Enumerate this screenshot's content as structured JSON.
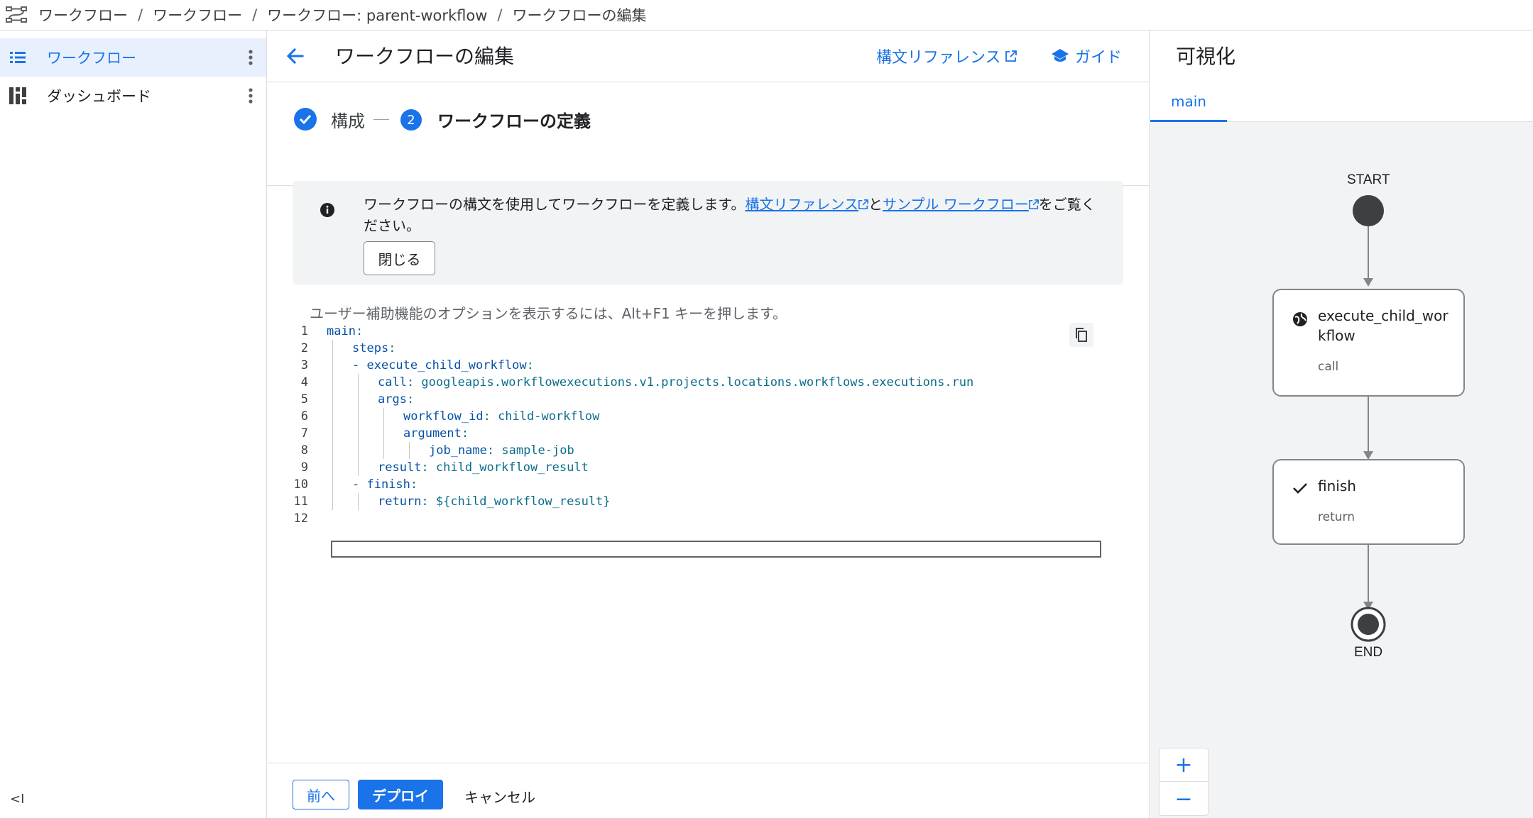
{
  "breadcrumb": {
    "items": [
      "ワークフロー",
      "ワークフロー",
      "ワークフロー: parent-workflow",
      "ワークフローの編集"
    ],
    "separator": "/"
  },
  "sidebar": {
    "items": [
      {
        "label": "ワークフロー",
        "icon": "list-icon",
        "active": true
      },
      {
        "label": "ダッシュボード",
        "icon": "dashboard-icon",
        "active": false
      }
    ],
    "collapse_label": "<I"
  },
  "editor": {
    "title": "ワークフローの編集",
    "syntax_ref_link": "構文リファレンス",
    "guide_link": "ガイド",
    "steps": [
      {
        "number": "1",
        "label": "構成",
        "done": true
      },
      {
        "number": "2",
        "label": "ワークフローの定義",
        "done": false
      }
    ],
    "info": {
      "text_before": "ワークフローの構文を使用してワークフローを定義します。",
      "link1": "構文リファレンス",
      "text_mid": "と",
      "link2": "サンプル ワークフロー",
      "text_after": "をご覧ください。",
      "close_label": "閉じる"
    },
    "a11y_hint": "ユーザー補助機能のオプションを表示するには、Alt+F1 キーを押します。",
    "code_lines": [
      {
        "n": "1",
        "indent": 0,
        "key": "main",
        "rest": ":"
      },
      {
        "n": "2",
        "indent": 1,
        "key": "steps",
        "rest": ":"
      },
      {
        "n": "3",
        "indent": 1,
        "key": "- execute_child_workflow",
        "rest": ":"
      },
      {
        "n": "4",
        "indent": 2,
        "key": "call",
        "rest": ": googleapis.workflowexecutions.v1.projects.locations.workflows.executions.run"
      },
      {
        "n": "5",
        "indent": 2,
        "key": "args",
        "rest": ":"
      },
      {
        "n": "6",
        "indent": 3,
        "key": "workflow_id",
        "rest": ": child-workflow"
      },
      {
        "n": "7",
        "indent": 3,
        "key": "argument",
        "rest": ":"
      },
      {
        "n": "8",
        "indent": 4,
        "key": "job_name",
        "rest": ": sample-job"
      },
      {
        "n": "9",
        "indent": 2,
        "key": "result",
        "rest": ": child_workflow_result"
      },
      {
        "n": "10",
        "indent": 1,
        "key": "- finish",
        "rest": ":"
      },
      {
        "n": "11",
        "indent": 2,
        "key": "return",
        "rest": ": ${child_workflow_result}"
      },
      {
        "n": "12",
        "indent": 0,
        "key": "",
        "rest": ""
      }
    ],
    "footer": {
      "prev_label": "前へ",
      "deploy_label": "デプロイ",
      "cancel_label": "キャンセル"
    }
  },
  "visualization": {
    "title": "可視化",
    "tab": "main",
    "start_label": "START",
    "end_label": "END",
    "nodes": [
      {
        "title_line1": "execute_child_wor",
        "title_line2": "kflow",
        "subtitle": "call",
        "icon": "globe-icon"
      },
      {
        "title_line1": "finish",
        "title_line2": "",
        "subtitle": "return",
        "icon": "check-icon"
      }
    ],
    "zoom_in": "+",
    "zoom_out": "−"
  },
  "colors": {
    "accent": "#1a73e8",
    "active_bg": "#e8f0fe",
    "panel_bg": "#f1f3f4",
    "code_key": "#0451a5",
    "code_value": "#0b6c8c"
  }
}
